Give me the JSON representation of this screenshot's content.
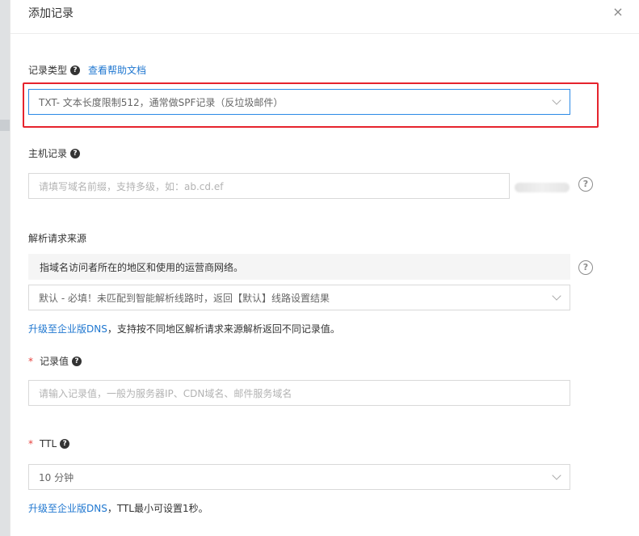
{
  "dialog": {
    "title": "添加记录",
    "close_icon": "×"
  },
  "record_type": {
    "label": "记录类型",
    "help_link": "查看帮助文档",
    "value": "TXT- 文本长度限制512，通常做SPF记录（反垃圾邮件）"
  },
  "host_record": {
    "label": "主机记录",
    "placeholder": "请填写域名前缀，支持多级，如：ab.cd.ef"
  },
  "resolve_source": {
    "label": "解析请求来源",
    "hint": "指域名访问者所在的地区和使用的运营商网络。",
    "value": "默认 - 必填！未匹配到智能解析线路时，返回【默认】线路设置结果",
    "upgrade_link": "升级至企业版DNS",
    "upgrade_text": "，支持按不同地区解析请求来源解析返回不同记录值。"
  },
  "record_value": {
    "required_mark": "*",
    "label": "记录值",
    "placeholder": "请输入记录值，一般为服务器IP、CDN域名、邮件服务域名"
  },
  "ttl": {
    "required_mark": "*",
    "label": "TTL",
    "value": "10 分钟",
    "upgrade_link": "升级至企业版DNS",
    "upgrade_text": "，TTL最小可设置1秒。"
  },
  "icons": {
    "question": "?",
    "chevron": "chevron-down-icon"
  },
  "colors": {
    "link": "#1f77d0",
    "required": "#e6413d",
    "highlight_frame": "#e6232d",
    "focus_border": "#2b8ae6"
  }
}
